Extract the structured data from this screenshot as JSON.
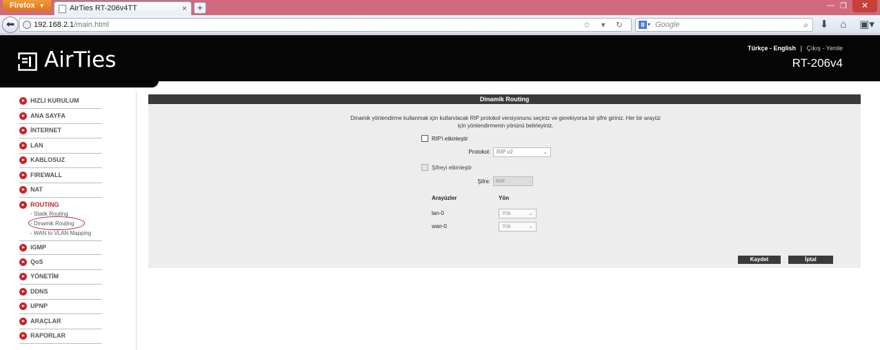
{
  "browser": {
    "menu_button": "Firefox",
    "tab_title": "AirTies RT-206v4TT",
    "new_tab": "+",
    "url_host": "192.168.2.1",
    "url_path": "/main.html",
    "search_placeholder": "Google"
  },
  "header": {
    "logo": "AirTies",
    "lang_tr": "Türkçe",
    "lang_sep1": " - ",
    "lang_en": "English",
    "sep": "|",
    "logout": "Çıkış",
    "lang_sep2": " - ",
    "refresh": "Yenile",
    "model": "RT-206v4"
  },
  "sidebar": {
    "items": [
      {
        "label": "HIZLI KURULUM"
      },
      {
        "label": "ANA SAYFA"
      },
      {
        "label": "İNTERNET"
      },
      {
        "label": "LAN"
      },
      {
        "label": "KABLOSUZ"
      },
      {
        "label": "FIREWALL"
      },
      {
        "label": "NAT"
      },
      {
        "label": "ROUTING"
      },
      {
        "label": "IGMP"
      },
      {
        "label": "QoS"
      },
      {
        "label": "YÖNETİM"
      },
      {
        "label": "DDNS"
      },
      {
        "label": "UPNP"
      },
      {
        "label": "ARAÇLAR"
      },
      {
        "label": "RAPORLAR"
      }
    ],
    "routing_sub": [
      {
        "label": "- Statik Routing"
      },
      {
        "label": "- Dinamik Routing"
      },
      {
        "label": "- WAN to VLAN Mapping"
      }
    ]
  },
  "main": {
    "title": "Dinamik Routing",
    "description_line1": "Dinamik yönlendirme kullanmak için kullanılacak RIP protokol versiyonunu seçiniz ve gerekiyorsa bir şifre giriniz. Her bir arayüz",
    "description_line2": "için yönlendirmenin yönünü belirleyiniz.",
    "rip_enable_label": "RIP'i etkinleştir",
    "protocol_label": "Protokol:",
    "protocol_value": "RIP v2",
    "password_enable_label": "Şifreyi etkinleştir",
    "password_label": "Şifre:",
    "password_value": "test",
    "interfaces_header": "Arayüzler",
    "direction_header": "Yön",
    "interfaces": [
      {
        "name": "lan-0",
        "direction": "Yok"
      },
      {
        "name": "wan-0",
        "direction": "Yok"
      }
    ],
    "save_label": "Kaydet",
    "cancel_label": "İptal"
  }
}
